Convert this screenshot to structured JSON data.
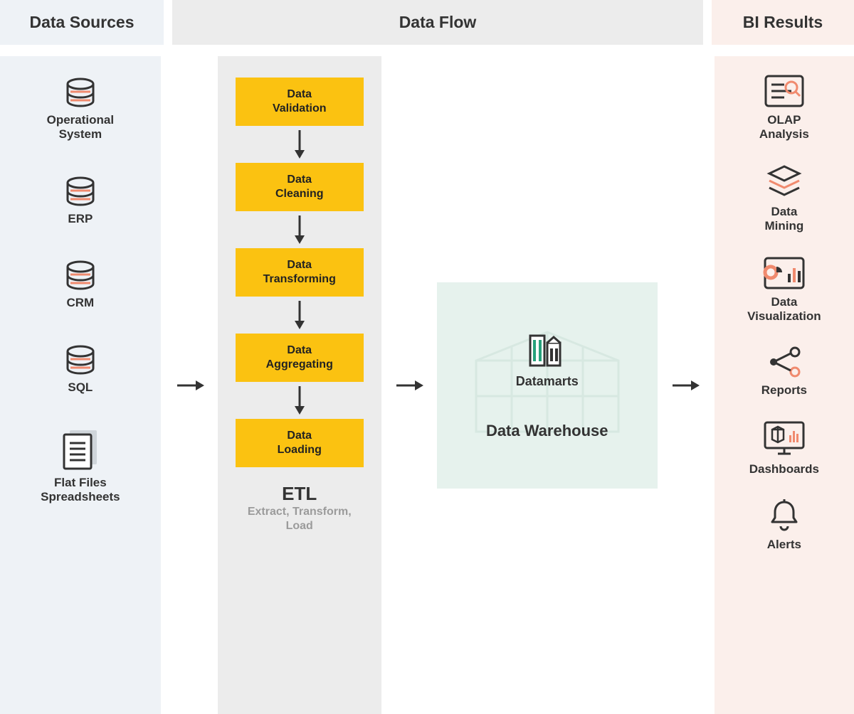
{
  "headers": {
    "sources": "Data Sources",
    "flow": "Data Flow",
    "results": "BI Results"
  },
  "sources": [
    {
      "icon": "db",
      "label": "Operational\nSystem"
    },
    {
      "icon": "db",
      "label": "ERP"
    },
    {
      "icon": "db",
      "label": "CRM"
    },
    {
      "icon": "db",
      "label": "SQL"
    },
    {
      "icon": "file",
      "label": "Flat Files\nSpreadsheets"
    }
  ],
  "flow": {
    "etl": {
      "title": "ETL",
      "subtitle": "Extract, Transform,\nLoad",
      "steps": [
        "Data\nValidation",
        "Data\nCleaning",
        "Data\nTransforming",
        "Data\nAggregating",
        "Data\nLoading"
      ]
    },
    "warehouse": {
      "datamarts_label": "Datamarts",
      "label": "Data Warehouse"
    }
  },
  "results": [
    {
      "icon": "olap",
      "label": "OLAP\nAnalysis"
    },
    {
      "icon": "stack",
      "label": "Data\nMining"
    },
    {
      "icon": "viz",
      "label": "Data\nVisualization"
    },
    {
      "icon": "reports",
      "label": "Reports"
    },
    {
      "icon": "dash",
      "label": "Dashboards"
    },
    {
      "icon": "bell",
      "label": "Alerts"
    }
  ],
  "colors": {
    "accent": "#f08a6e",
    "step": "#fbc211",
    "ink": "#333333",
    "dw_bg": "#e6f2ed",
    "src_bg": "#eef2f6",
    "etl_bg": "#ececec",
    "res_bg": "#fbefeb"
  }
}
